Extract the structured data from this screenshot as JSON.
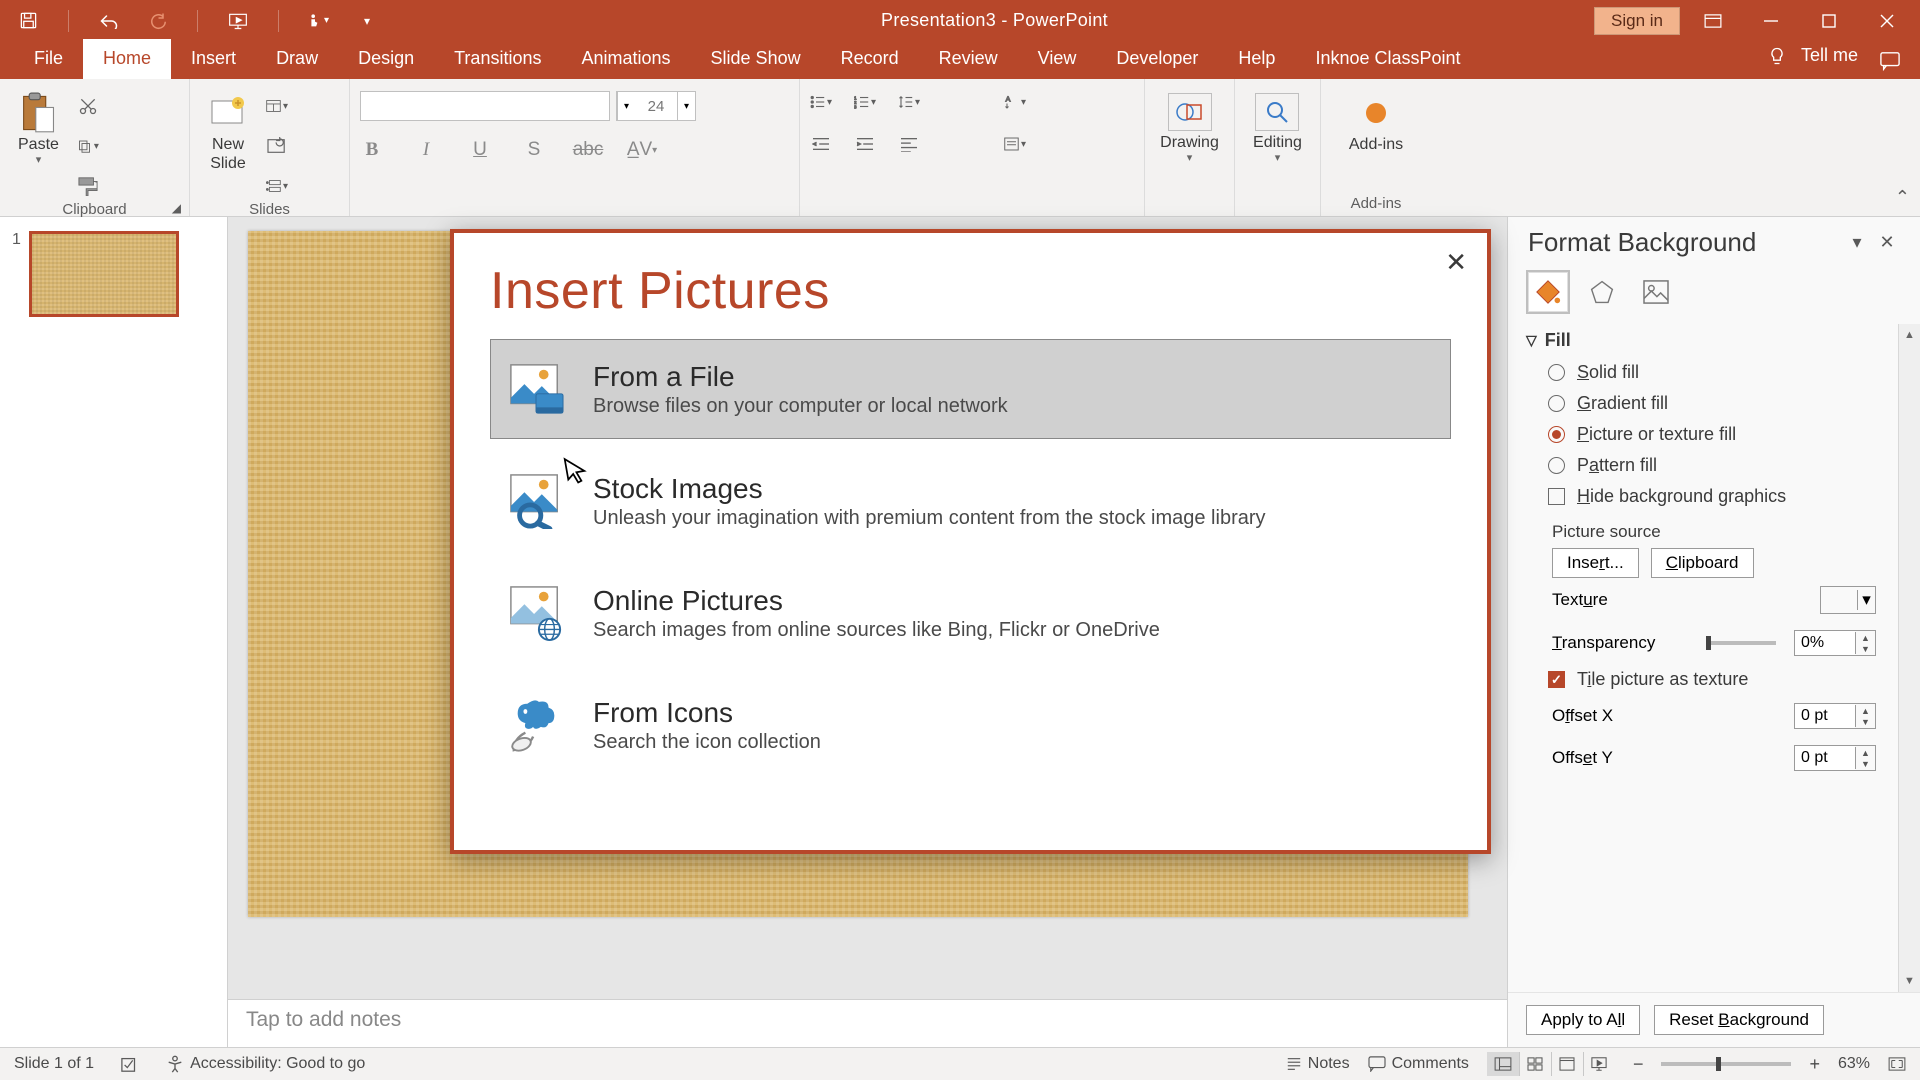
{
  "titlebar": {
    "title": "Presentation3  -  PowerPoint",
    "signin": "Sign in"
  },
  "tabs": {
    "file": "File",
    "home": "Home",
    "insert": "Insert",
    "draw": "Draw",
    "design": "Design",
    "transitions": "Transitions",
    "animations": "Animations",
    "slideshow": "Slide Show",
    "record": "Record",
    "review": "Review",
    "view": "View",
    "developer": "Developer",
    "help": "Help",
    "classpoint": "Inknoe ClassPoint",
    "tellme": "Tell me"
  },
  "ribbon": {
    "clipboard": {
      "paste": "Paste",
      "label": "Clipboard"
    },
    "slides": {
      "newslide": "New\nSlide",
      "label": "Slides"
    },
    "font": {
      "size": "24"
    },
    "drawing": {
      "label": "Drawing"
    },
    "editing": {
      "label": "Editing"
    },
    "addins": {
      "label": "Add-ins"
    }
  },
  "thumb": {
    "num": "1"
  },
  "notes": {
    "placeholder": "Tap to add notes"
  },
  "modal": {
    "title": "Insert Pictures",
    "options": [
      {
        "title": "From a File",
        "desc": "Browse files on your computer or local network"
      },
      {
        "title": "Stock Images",
        "desc": "Unleash your imagination with premium content from the stock image library"
      },
      {
        "title": "Online Pictures",
        "desc": "Search images from online sources like Bing, Flickr or OneDrive"
      },
      {
        "title": "From Icons",
        "desc": "Search the icon collection"
      }
    ]
  },
  "format": {
    "title": "Format Background",
    "fill_section": "Fill",
    "solid": "Solid fill",
    "gradient": "Gradient fill",
    "picture": "Picture or texture fill",
    "pattern": "Pattern fill",
    "hide": "Hide background graphics",
    "picsource": "Picture source",
    "insert": "Insert...",
    "clipboard": "Clipboard",
    "texture": "Texture",
    "transparency": "Transparency",
    "transparency_val": "0%",
    "tile": "Tile picture as texture",
    "offsetx": "Offset X",
    "offsetx_val": "0 pt",
    "offsety": "Offset Y",
    "offsety_val": "0 pt",
    "apply": "Apply to All",
    "reset": "Reset Background"
  },
  "status": {
    "slide": "Slide 1 of 1",
    "accessibility": "Accessibility: Good to go",
    "notes": "Notes",
    "comments": "Comments",
    "zoom": "63%"
  }
}
